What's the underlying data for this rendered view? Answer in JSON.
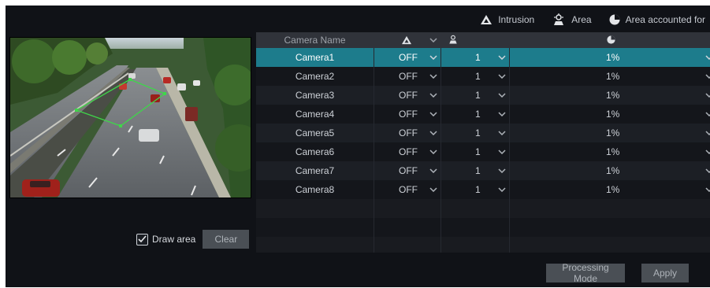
{
  "legend": {
    "intrusion_label": "Intrusion",
    "area_label": "Area",
    "accounted_label": "Area accounted for"
  },
  "table": {
    "header_name": "Camera Name",
    "rows": [
      {
        "name": "Camera1",
        "intrusion": "OFF",
        "area": "1",
        "pct": "1%"
      },
      {
        "name": "Camera2",
        "intrusion": "OFF",
        "area": "1",
        "pct": "1%"
      },
      {
        "name": "Camera3",
        "intrusion": "OFF",
        "area": "1",
        "pct": "1%"
      },
      {
        "name": "Camera4",
        "intrusion": "OFF",
        "area": "1",
        "pct": "1%"
      },
      {
        "name": "Camera5",
        "intrusion": "OFF",
        "area": "1",
        "pct": "1%"
      },
      {
        "name": "Camera6",
        "intrusion": "OFF",
        "area": "1",
        "pct": "1%"
      },
      {
        "name": "Camera7",
        "intrusion": "OFF",
        "area": "1",
        "pct": "1%"
      },
      {
        "name": "Camera8",
        "intrusion": "OFF",
        "area": "1",
        "pct": "1%"
      }
    ]
  },
  "controls": {
    "draw_area_label": "Draw area",
    "draw_area_checked": true,
    "clear_label": "Clear",
    "processing_mode_label": "Processing Mode",
    "apply_label": "Apply"
  },
  "colors": {
    "selected_row": "#1d7c8c",
    "zone_outline": "#3fd64a"
  }
}
